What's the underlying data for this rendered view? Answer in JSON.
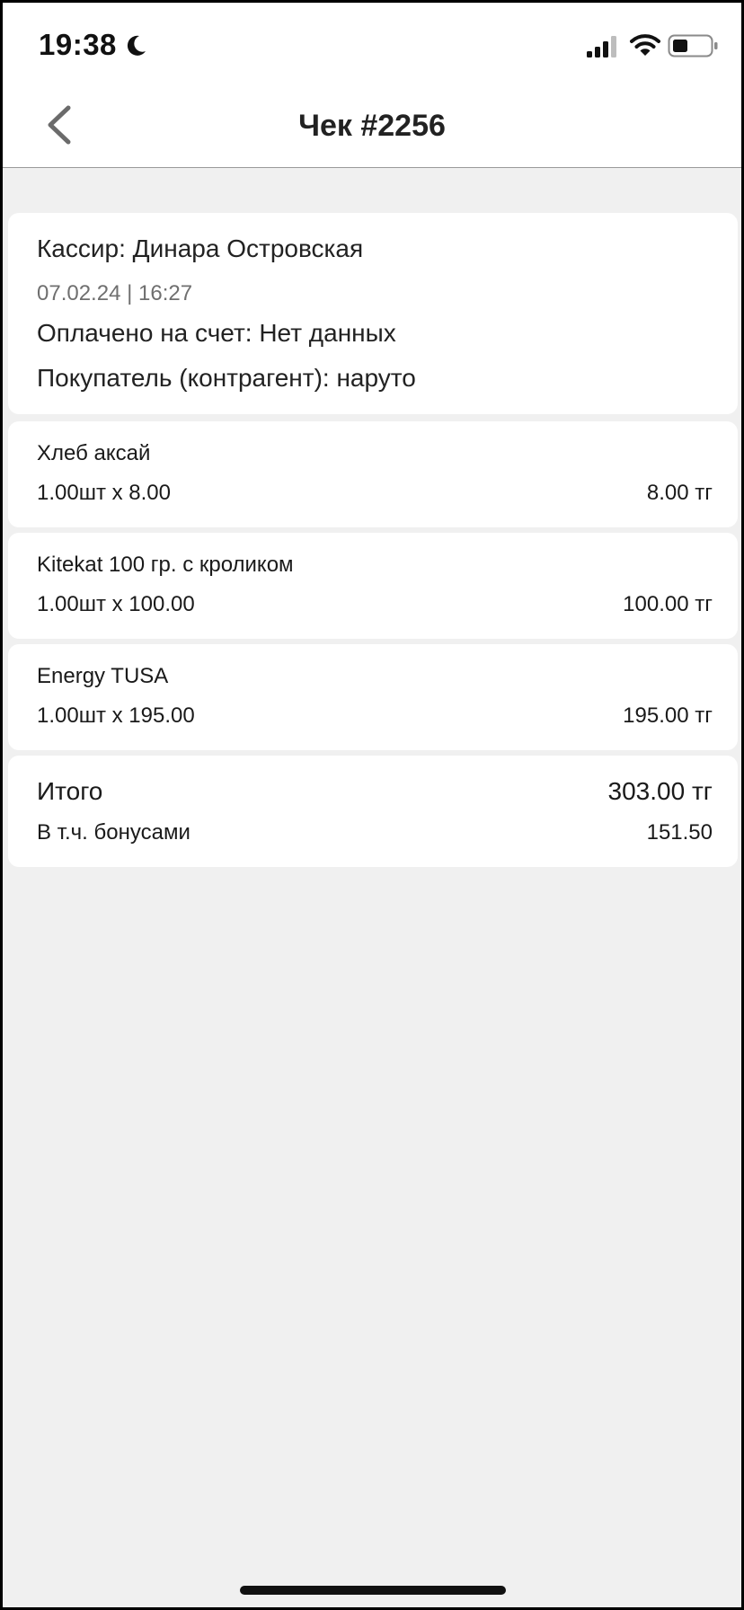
{
  "status_bar": {
    "time": "19:38",
    "icons": [
      "moon-icon",
      "signal-icon",
      "wifi-icon",
      "battery-icon"
    ]
  },
  "nav": {
    "title": "Чек #2256",
    "back_icon": "chevron-left-icon"
  },
  "receipt_info": {
    "cashier": "Кассир: Динара Островская",
    "datetime": "07.02.24 | 16:27",
    "paid_to": "Оплачено на счет: Нет данных",
    "customer": "Покупатель (контрагент): наруто"
  },
  "items": [
    {
      "name": "Хлеб аксай",
      "qty_price": "1.00шт x 8.00",
      "total": "8.00 тг"
    },
    {
      "name": "Kitekat 100 гр. с кроликом",
      "qty_price": "1.00шт x 100.00",
      "total": "100.00 тг"
    },
    {
      "name": "Energy TUSA",
      "qty_price": "1.00шт x 195.00",
      "total": "195.00 тг"
    }
  ],
  "summary": {
    "total_label": "Итого",
    "total_value": "303.00 тг",
    "bonus_label": "В т.ч. бонусами",
    "bonus_value": "151.50"
  },
  "colors": {
    "background": "#f0f0f0",
    "card": "#ffffff",
    "text": "#1a1a1a",
    "muted": "#6f6f6f"
  }
}
